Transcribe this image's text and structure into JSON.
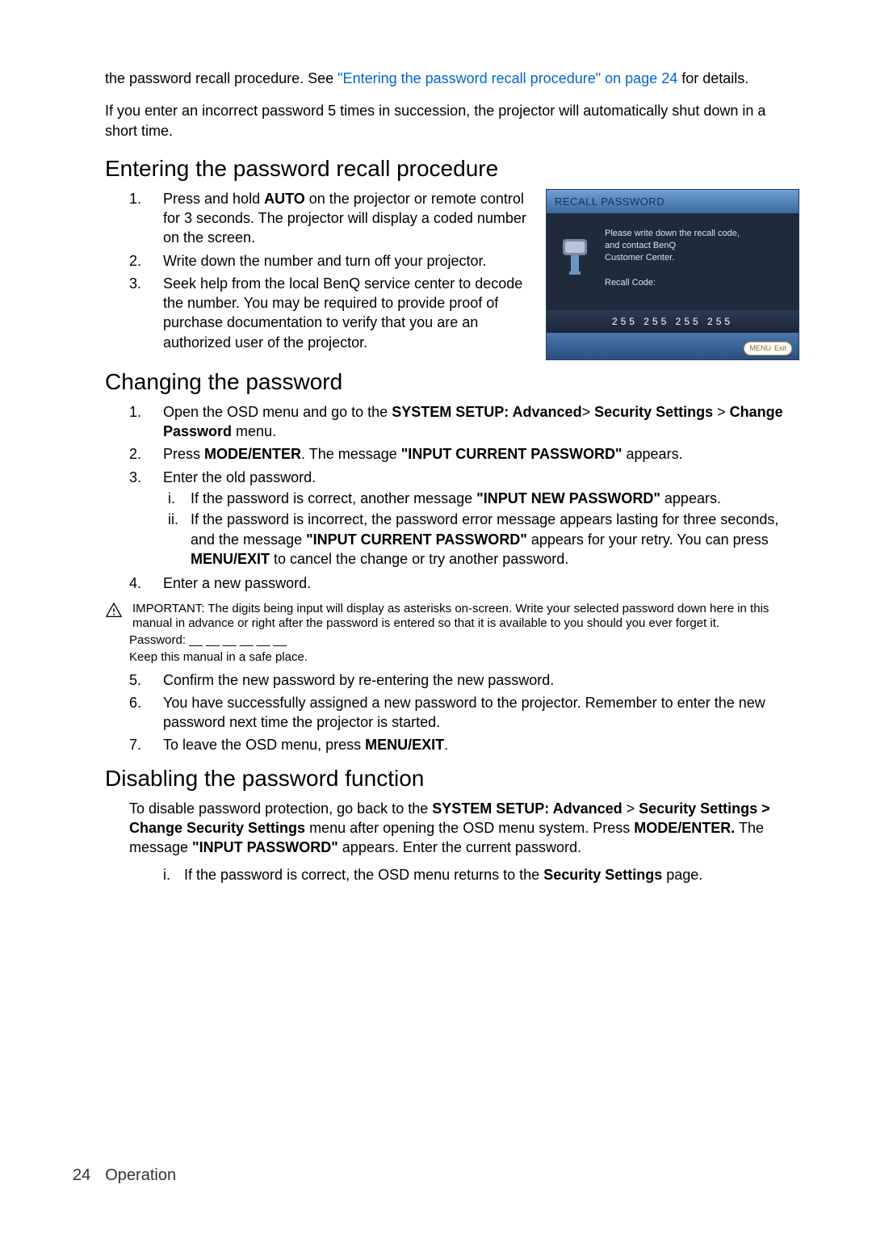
{
  "intro": {
    "pre_link": "the password recall procedure. See ",
    "link": "\"Entering the password recall procedure\" on page 24",
    "post_link": " for details.",
    "para2": "If you enter an incorrect password 5 times in succession, the projector will automatically shut down in a short time."
  },
  "section1": {
    "title": "Entering the password recall procedure",
    "items": [
      {
        "n": "1.",
        "t_pre": "Press and hold ",
        "t_b": "AUTO",
        "t_post": " on the projector or remote control for 3 seconds. The projector will display a coded number on the screen."
      },
      {
        "n": "2.",
        "t": "Write down the number and turn off your projector."
      },
      {
        "n": "3.",
        "t": "Seek help from the local BenQ service center to decode the number. You may be required to provide proof of purchase documentation to verify that you are an authorized user of the projector."
      }
    ]
  },
  "osd": {
    "title": "RECALL PASSWORD",
    "msg_l1": "Please write down the recall code,",
    "msg_l2": "and contact BenQ",
    "msg_l3": "Customer Center.",
    "label": "Recall Code:",
    "code": "255  255  255  255",
    "menu": "MENU",
    "exit": "Exit"
  },
  "section2": {
    "title": "Changing the password",
    "items_a": [
      {
        "n": "1.",
        "pre": "Open the OSD menu and go to the ",
        "b1": "SYSTEM SETUP: Advanced",
        "mid": "> ",
        "b2": "Security Settings",
        "mid2": " > ",
        "b3": "Change Password",
        "post": " menu."
      },
      {
        "n": "2.",
        "pre": "Press ",
        "b1": "MODE/ENTER",
        "mid": ". The message ",
        "b2": "\"INPUT CURRENT PASSWORD\"",
        "post": " appears."
      },
      {
        "n": "3.",
        "t": "Enter the old password."
      }
    ],
    "sub": [
      {
        "n": "i.",
        "pre": "If the password is correct, another message ",
        "b": "\"INPUT NEW PASSWORD\"",
        "post": " appears."
      },
      {
        "n": "ii.",
        "pre": "If the password is incorrect, the password error message appears lasting for three seconds, and the message ",
        "b": "\"INPUT CURRENT PASSWORD\"",
        "mid": " appears for your retry. You can press ",
        "b2": "MENU/EXIT",
        "post": " to cancel the change or try another password."
      }
    ],
    "item4": {
      "n": "4.",
      "t": "Enter a new password."
    },
    "note": "IMPORTANT: The digits being input will display as asterisks on-screen. Write your selected password down here in this manual in advance or right after the password is entered so that it is available to you should you ever forget it.",
    "pw_line": "Password: __ __ __ __ __ __",
    "keep": "Keep this manual in a safe place.",
    "items_b": [
      {
        "n": "5.",
        "t": "Confirm the new password by re-entering the new password."
      },
      {
        "n": "6.",
        "t": "You have successfully assigned a new password to the projector. Remember to enter the new password next time the projector is started."
      },
      {
        "n": "7.",
        "pre": "To leave the OSD menu, press ",
        "b": "MENU/EXIT",
        "post": "."
      }
    ]
  },
  "section3": {
    "title": "Disabling the password function",
    "p_pre": "To disable password protection, go back to the ",
    "p_b1": "SYSTEM SETUP: Advanced",
    "p_mid1": " > ",
    "p_b2": "Security Settings > Change Security Settings",
    "p_mid2": " menu after opening the OSD menu system. Press ",
    "p_b3": "MODE/ENTER.",
    "p_mid3": " The message ",
    "p_b4": "\"INPUT PASSWORD\"",
    "p_post": " appears. Enter the current password.",
    "sub": {
      "n": "i.",
      "pre": "If the password is correct, the OSD menu returns to the ",
      "b": "Security Settings",
      "post": " page."
    }
  },
  "footer": {
    "page": "24",
    "label": "Operation"
  }
}
